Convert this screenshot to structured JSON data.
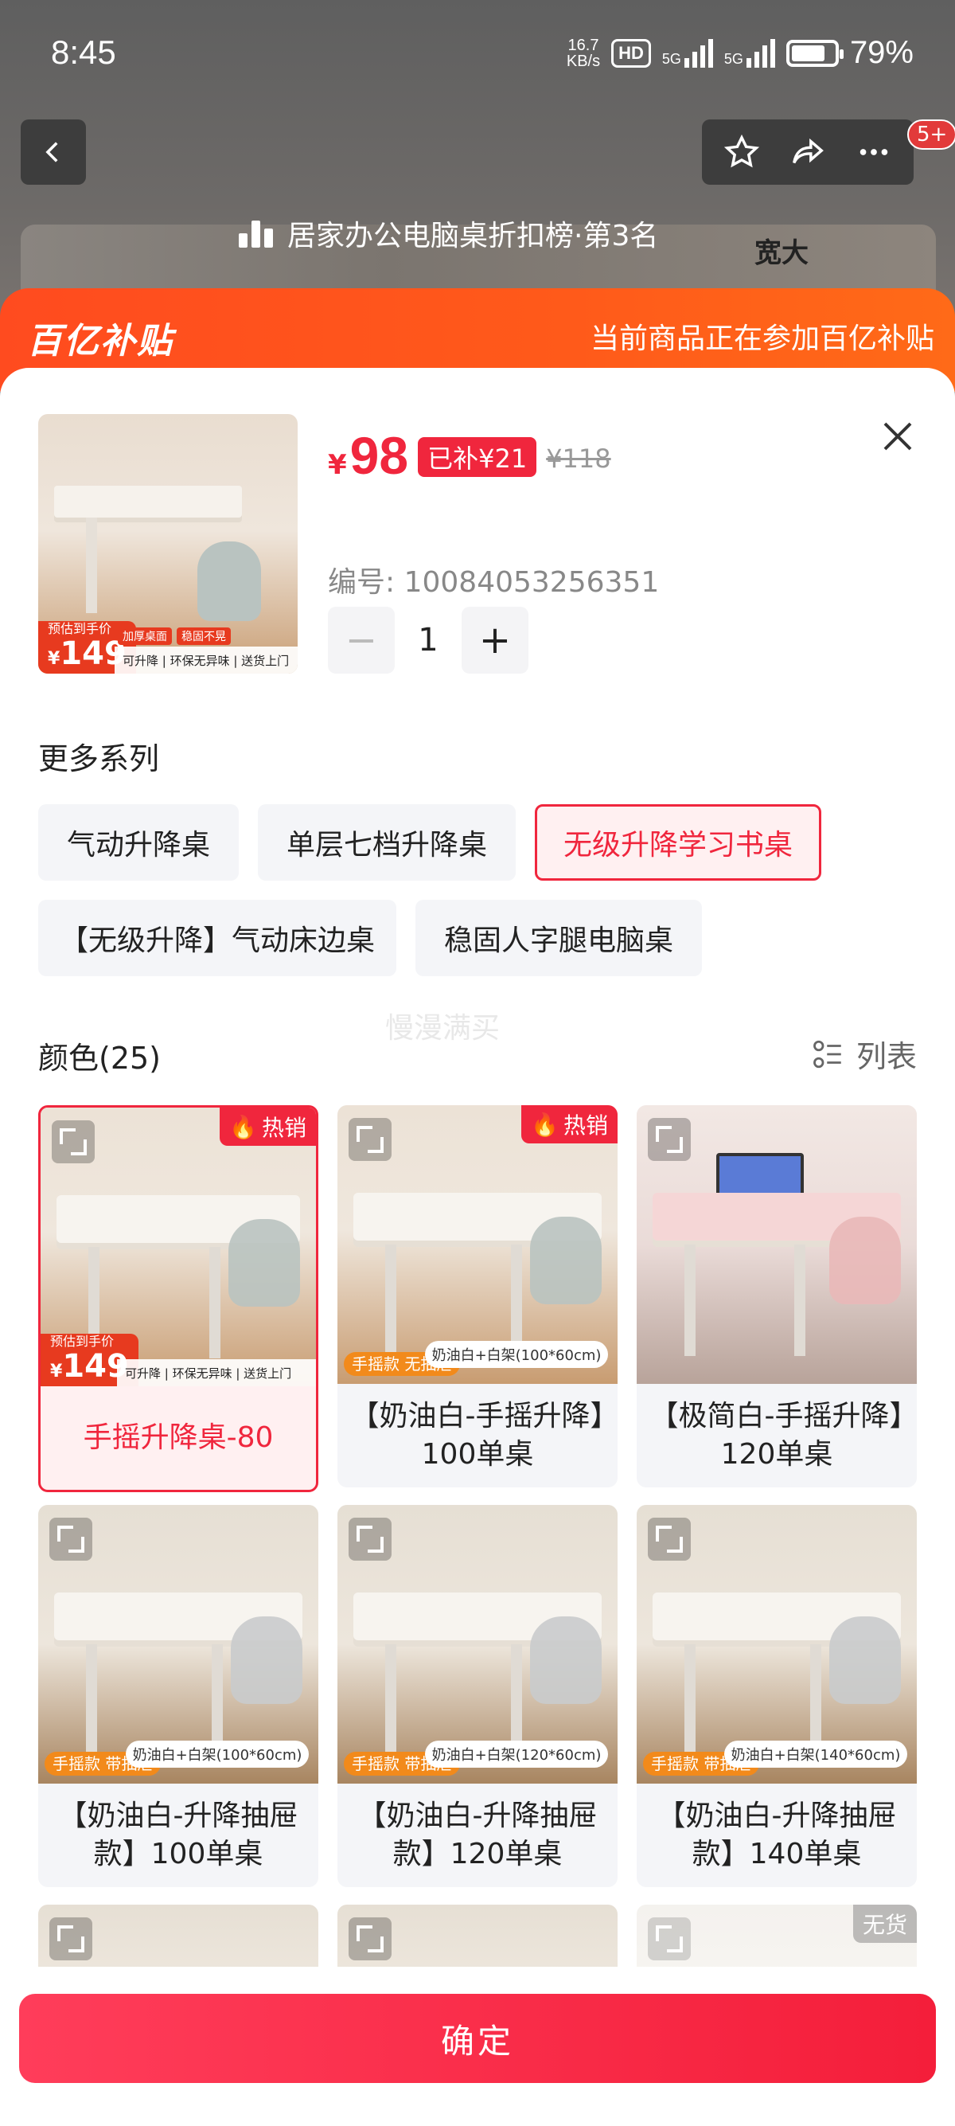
{
  "status_bar": {
    "time": "8:45",
    "net_speed_top": "16.7",
    "net_speed_bottom": "KB/s",
    "hd_label": "HD",
    "sim1_label": "5G",
    "sim2_label": "5G",
    "battery_percent": "79%",
    "battery_level": 0.79
  },
  "top_nav": {
    "notification_badge": "5+",
    "ranking_text": "居家办公电脑桌折扣榜·第3名",
    "bg_product_text": "宽大"
  },
  "subsidy": {
    "logo": "百亿补贴",
    "note": "当前商品正在参加百亿补贴"
  },
  "product": {
    "currency": "¥",
    "price": "98",
    "subsidy_tag": "已补¥21",
    "original_price": "¥118",
    "sku_number": "编号: 10084053256351",
    "quantity": "1",
    "thumb_price": "149",
    "thumb_price_label": "预估到手价",
    "thumb_strip": "可升降 | 环保无异味 | 送货上门",
    "thumb_tag1": "加厚桌面",
    "thumb_tag2": "稳固不晃"
  },
  "series": {
    "title": "更多系列",
    "items": [
      {
        "label": "气动升降桌",
        "active": false
      },
      {
        "label": "单层七档升降桌",
        "active": false
      },
      {
        "label": "无级升降学习书桌",
        "active": true
      },
      {
        "label": "【无级升降】气动床边桌",
        "active": false
      },
      {
        "label": "稳固人字腿电脑桌",
        "active": false
      }
    ]
  },
  "colors": {
    "title": "颜色(25)",
    "list_toggle": "列表",
    "watermark": "慢漫满买",
    "hot_label": "热销",
    "out_of_stock_label": "无货",
    "items": [
      {
        "caption": "手摇升降桌-80",
        "active": true,
        "hot": true,
        "promo": "",
        "spec": "",
        "price_chip": "149"
      },
      {
        "caption": "【奶油白-手摇升降】100单桌",
        "active": false,
        "hot": true,
        "promo": "手摇款 无抽屉",
        "spec": "奶油白+白架(100*60cm)",
        "price_chip": ""
      },
      {
        "caption": "【极简白-手摇升降】120单桌",
        "active": false,
        "hot": false,
        "promo": "",
        "spec": "",
        "price_chip": ""
      },
      {
        "caption": "【奶油白-升降抽屉款】100单桌",
        "active": false,
        "hot": false,
        "promo": "手摇款 带抽屉",
        "spec": "奶油白+白架(100*60cm)",
        "price_chip": ""
      },
      {
        "caption": "【奶油白-升降抽屉款】120单桌",
        "active": false,
        "hot": false,
        "promo": "手摇款 带抽屉",
        "spec": "奶油白+白架(120*60cm)",
        "price_chip": ""
      },
      {
        "caption": "【奶油白-升降抽屉款】140单桌",
        "active": false,
        "hot": false,
        "promo": "手摇款 带抽屉",
        "spec": "奶油白+白架(140*60cm)",
        "price_chip": ""
      }
    ]
  },
  "confirm_label": "确定",
  "colors_palette": {
    "accent_red": "#f0263d",
    "subsidy_orange": "#ff4b1f"
  }
}
